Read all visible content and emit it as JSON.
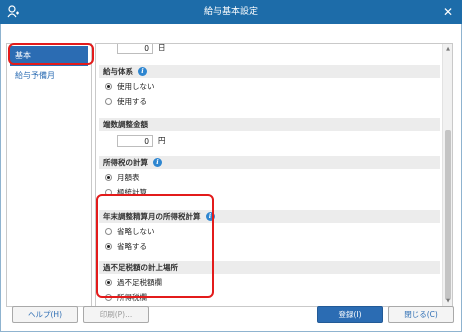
{
  "window": {
    "title": "給与基本設定",
    "close_glyph": "✕",
    "app_icon": "person-plus-icon"
  },
  "sidebar": {
    "items": [
      {
        "label": "基本",
        "active": true
      },
      {
        "label": "給与予備月",
        "active": false
      }
    ]
  },
  "top_field": {
    "value": "0",
    "unit": "日"
  },
  "sections": {
    "pay_system": {
      "heading": "給与体系",
      "options": [
        "使用しない",
        "使用する"
      ],
      "selected": 0
    },
    "rounding_adjustment": {
      "heading": "端数調整金額",
      "value": "0",
      "unit": "円"
    },
    "income_tax_calc": {
      "heading": "所得税の計算",
      "options": [
        "月額表",
        "極統計算"
      ],
      "selected": 0
    },
    "year_end_tax": {
      "heading": "年末調整精算月の所得税計算",
      "options": [
        "省略しない",
        "省略する"
      ],
      "selected": 1
    },
    "shortfall_tax_field": {
      "heading": "過不足税額の計上場所",
      "options": [
        "過不足税額欄",
        "所得税欄"
      ],
      "selected": 0
    }
  },
  "footer": {
    "help_label": "ヘルプ(H)",
    "print_label": "印刷(P)...",
    "register_label": "登録(I)",
    "close_label": "閉じる(C)"
  },
  "colors": {
    "titlebar": "#1d6ca9",
    "accent": "#2b6cb3",
    "highlight": "#e31b1b"
  }
}
